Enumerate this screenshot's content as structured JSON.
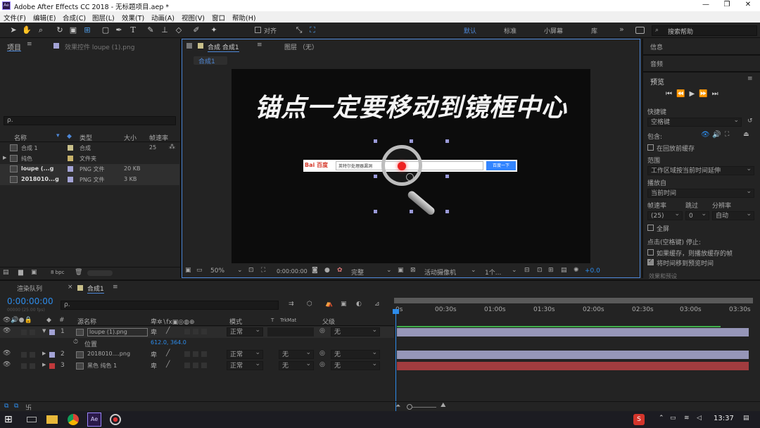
{
  "window": {
    "title": "Adobe After Effects CC 2018 - 无标题项目.aep *",
    "icon": "ae-app-icon"
  },
  "menu": [
    "文件(F)",
    "编辑(E)",
    "合成(C)",
    "图层(L)",
    "效果(T)",
    "动画(A)",
    "视图(V)",
    "窗口",
    "帮助(H)"
  ],
  "toolbar": {
    "align_label": "对齐",
    "workspaces": [
      "默认",
      "标准",
      "小屏幕",
      "库"
    ],
    "active_workspace": "默认",
    "more": "»",
    "search_placeholder": "搜索帮助"
  },
  "project": {
    "tab": "项目",
    "menu": "≡",
    "effects_tab": "效果控件 loupe (1).png",
    "search_value": "ρ.",
    "columns": [
      "名称",
      "类型",
      "大小",
      "帧速率"
    ],
    "items": [
      {
        "name": "合成 1",
        "type": "合成",
        "size": "",
        "fps": "25",
        "color": "#c9c08a"
      },
      {
        "name": "纯色",
        "type": "文件夹",
        "size": "",
        "fps": "",
        "color": "#c9b36a"
      },
      {
        "name": "loupe (...g",
        "type": "PNG 文件",
        "size": "20 KB",
        "fps": "",
        "color": "#a3a3d6"
      },
      {
        "name": "2018010...g",
        "type": "PNG 文件",
        "size": "3 KB",
        "fps": "",
        "color": "#a3a3d6"
      }
    ],
    "bpc": "8 bpc"
  },
  "comp": {
    "tab_label": "合成 合成1",
    "menu": "≡",
    "layer_tab": "图层 （无）",
    "crumb": "合成1",
    "canvas_text": "锚点一定要移动到镜框中心",
    "search_logo": "Bai 百度",
    "search_text": "英特尔处理器漏洞",
    "search_button": "百度一下",
    "zoom": "50%",
    "timecode": "0:00:00:00",
    "quality": "完整",
    "camera": "活动摄像机",
    "views": "1个...",
    "offset": "+0.0"
  },
  "right": {
    "info": "信息",
    "audio": "音频",
    "preview": "预览",
    "menu": "≡",
    "shortcut_label": "快捷键",
    "shortcut_value": "空格键",
    "include_label": "包含:",
    "cache_label": "在回放前缓存",
    "range_label": "范围",
    "range_value": "工作区域按当前时间延伸",
    "play_from_label": "播放自",
    "play_from_value": "当前时间",
    "fps_label": "帧速率",
    "skip_label": "跳过",
    "res_label": "分辨率",
    "fps_value": "(25)",
    "skip_value": "0",
    "res_value": "自动",
    "fullscreen_label": "全屏",
    "stop_label": "点击(空格键) 停止:",
    "stop_opt1": "如果缓存，则播放缓存的帧",
    "stop_opt2": "将时间移到预览时间",
    "cut_label": "效果和预设"
  },
  "timeline": {
    "render_tab": "渲染队列",
    "comp_tab": "合成1",
    "menu": "≡",
    "timecode": "0:00:00:00",
    "timecode_sub": "00000 (25.00 fps)",
    "search_value": "ρ.",
    "cols": {
      "num": "#",
      "name": "源名称",
      "mode": "模式",
      "t": "T",
      "trkmat": "TrkMat",
      "parent": "父级"
    },
    "ruler": [
      "0s",
      "00:30s",
      "01:00s",
      "01:30s",
      "02:00s",
      "02:30s",
      "03:00s",
      "03:30s"
    ],
    "layers": [
      {
        "num": "1",
        "name": "loupe (1).png",
        "mode": "正常",
        "trkmat": "",
        "parent": "无",
        "color": "#a3a3d6",
        "bar": "#9696b8"
      },
      {
        "num": "2",
        "name": "2018010....png",
        "mode": "正常",
        "trkmat": "无",
        "parent": "无",
        "color": "#a3a3d6",
        "bar": "#9696b8"
      },
      {
        "num": "3",
        "name": "黑色 纯色 1",
        "mode": "正常",
        "trkmat": "无",
        "parent": "无",
        "color": "#c0393b",
        "bar": "#a13c3f"
      }
    ],
    "position_label": "位置",
    "position_value": "612.0, 364.0"
  },
  "taskbar": {
    "time": "13:37"
  }
}
